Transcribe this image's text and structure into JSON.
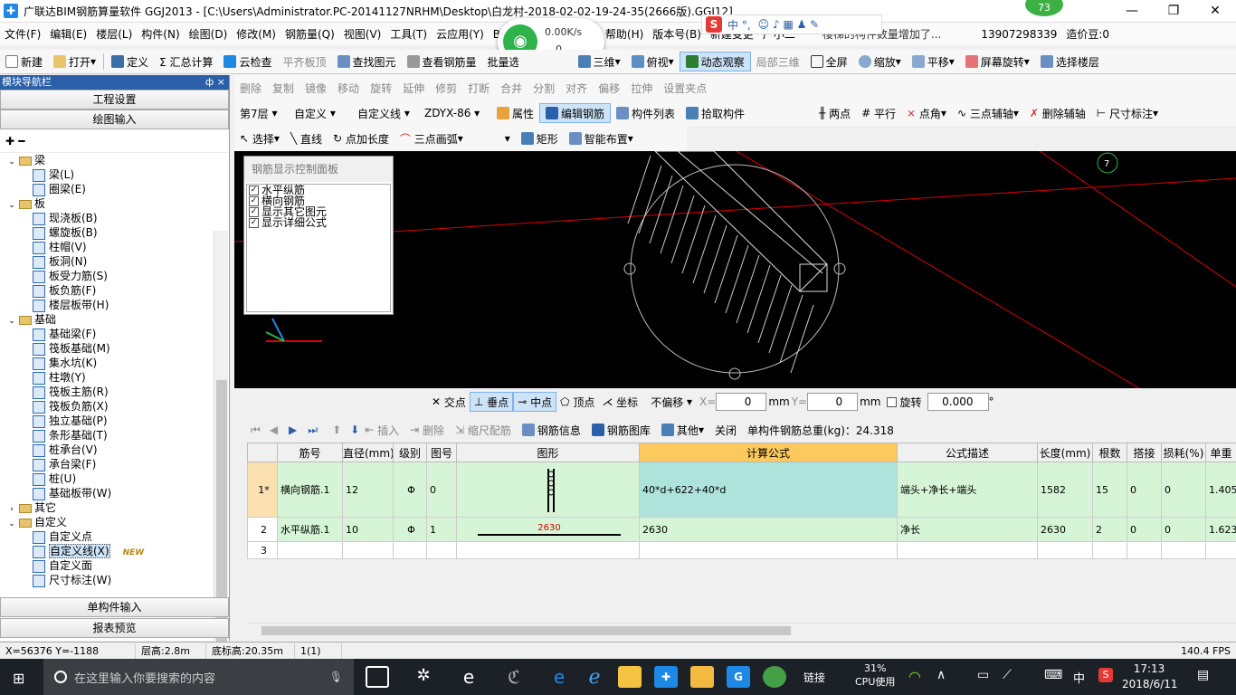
{
  "title": "广联达BIM钢筋算量软件 GGJ2013 - [C:\\Users\\Administrator.PC-20141127NRHM\\Desktop\\白龙村-2018-02-02-19-24-35(2666版).GGJ12]",
  "badge": "73",
  "net": {
    "speed": "0.00K/s",
    "count": "0"
  },
  "ime_strip": "中 °,",
  "menu": [
    "文件(F)",
    "编辑(E)",
    "楼层(L)",
    "构件(N)",
    "绘图(D)",
    "修改(M)",
    "钢筋量(Q)",
    "视图(V)",
    "工具(T)",
    "云应用(Y)",
    "BIM",
    "帮助(H)",
    "版本号(B)",
    "新建变更",
    "广小二"
  ],
  "notice": "楼梯的构件数量增加了...",
  "account": {
    "phone": "13907298339",
    "coins": "造价豆:0"
  },
  "toolbar1": [
    "新建",
    "打开",
    "定义",
    "Σ 汇总计算",
    "云检查",
    "平齐板顶",
    "查找图元",
    "查看钢筋量",
    "批量选择",
    "三维",
    "俯视",
    "动态观察",
    "局部三维",
    "全屏",
    "缩放",
    "平移",
    "屏幕旋转",
    "选择楼层"
  ],
  "toolbar2": [
    "删除",
    "复制",
    "镜像",
    "移动",
    "旋转",
    "延伸",
    "修剪",
    "打断",
    "合并",
    "分割",
    "对齐",
    "偏移",
    "拉伸",
    "设置夹点"
  ],
  "toolbar3": {
    "floor": "第7层",
    "type": "自定义",
    "sub": "自定义线",
    "name": "ZDYX-86",
    "items": [
      "属性",
      "编辑钢筋",
      "构件列表",
      "拾取构件",
      "两点",
      "平行",
      "点角",
      "三点辅轴",
      "删除辅轴",
      "尺寸标注"
    ]
  },
  "toolbar4": [
    "选择",
    "直线",
    "点加长度",
    "三点画弧",
    "矩形",
    "智能布置"
  ],
  "panel": {
    "header": "模块导航栏",
    "pin": "ф ×",
    "btn_project": "工程设置",
    "btn_draw": "绘图输入",
    "tree": [
      {
        "lvl": 0,
        "label": "梁",
        "folder": true
      },
      {
        "lvl": 1,
        "label": "梁(L)"
      },
      {
        "lvl": 1,
        "label": "圈梁(E)"
      },
      {
        "lvl": 0,
        "label": "板",
        "folder": true
      },
      {
        "lvl": 1,
        "label": "现浇板(B)"
      },
      {
        "lvl": 1,
        "label": "螺旋板(B)"
      },
      {
        "lvl": 1,
        "label": "柱帽(V)"
      },
      {
        "lvl": 1,
        "label": "板洞(N)"
      },
      {
        "lvl": 1,
        "label": "板受力筋(S)"
      },
      {
        "lvl": 1,
        "label": "板负筋(F)"
      },
      {
        "lvl": 1,
        "label": "楼层板带(H)"
      },
      {
        "lvl": 0,
        "label": "基础",
        "folder": true
      },
      {
        "lvl": 1,
        "label": "基础梁(F)"
      },
      {
        "lvl": 1,
        "label": "筏板基础(M)"
      },
      {
        "lvl": 1,
        "label": "集水坑(K)"
      },
      {
        "lvl": 1,
        "label": "柱墩(Y)"
      },
      {
        "lvl": 1,
        "label": "筏板主筋(R)"
      },
      {
        "lvl": 1,
        "label": "筏板负筋(X)"
      },
      {
        "lvl": 1,
        "label": "独立基础(P)"
      },
      {
        "lvl": 1,
        "label": "条形基础(T)"
      },
      {
        "lvl": 1,
        "label": "桩承台(V)"
      },
      {
        "lvl": 1,
        "label": "承台梁(F)"
      },
      {
        "lvl": 1,
        "label": "桩(U)"
      },
      {
        "lvl": 1,
        "label": "基础板带(W)"
      },
      {
        "lvl": 0,
        "label": "其它",
        "folder": true,
        "collapsed": true
      },
      {
        "lvl": 0,
        "label": "自定义",
        "folder": true
      },
      {
        "lvl": 1,
        "label": "自定义点"
      },
      {
        "lvl": 1,
        "label": "自定义线(X)",
        "selected": true,
        "new": "NEW"
      },
      {
        "lvl": 1,
        "label": "自定义面"
      },
      {
        "lvl": 1,
        "label": "尺寸标注(W)"
      }
    ],
    "btn_single": "单构件输入",
    "btn_report": "报表预览"
  },
  "ctrl_panel": {
    "title": "钢筋显示控制面板",
    "items": [
      "水平纵筋",
      "横向钢筋",
      "显示其它图元",
      "显示详细公式"
    ]
  },
  "viewport": {
    "axis_label": "7"
  },
  "snap": {
    "items": [
      "交点",
      "垂点",
      "中点",
      "顶点",
      "坐标"
    ],
    "offset": "不偏移",
    "x_label": "X=",
    "x": "0",
    "y_label": "Y=",
    "y": "0",
    "unit": "mm",
    "rotate": "旋转",
    "angle": "0.000",
    "deg": "°"
  },
  "gridtb": {
    "items": [
      "插入",
      "删除",
      "缩尺配筋",
      "钢筋信息",
      "钢筋图库",
      "其他",
      "关闭"
    ],
    "total": "单构件钢筋总重(kg)：24.318"
  },
  "table": {
    "columns": [
      "",
      "筋号",
      "直径(mm)",
      "级别",
      "图号",
      "图形",
      "计算公式",
      "公式描述",
      "长度(mm)",
      "根数",
      "搭接",
      "损耗(%)",
      "单重"
    ],
    "rows": [
      [
        "1*",
        "横向钢筋.1",
        "12",
        "Φ",
        "0",
        "",
        "40*d+622+40*d",
        "端头+净长+端头",
        "1582",
        "15",
        "0",
        "0",
        "1.405"
      ],
      [
        "2",
        "水平纵筋.1",
        "10",
        "Φ",
        "1",
        "2630",
        "2630",
        "净长",
        "2630",
        "2",
        "0",
        "0",
        "1.623"
      ],
      [
        "3",
        "",
        "",
        "",
        "",
        "",
        "",
        "",
        "",
        "",
        "",
        "",
        ""
      ]
    ]
  },
  "status": [
    "X=56376 Y=-1188",
    "层高:2.8m",
    "底标高:20.35m",
    "1(1)",
    "140.4 FPS"
  ],
  "taskbar": {
    "search": "在这里输入你要搜索的内容",
    "link": "链接",
    "cpu": "31%",
    "cpu_label": "CPU使用",
    "ime": "中",
    "time": "17:13",
    "date": "2018/6/11"
  }
}
